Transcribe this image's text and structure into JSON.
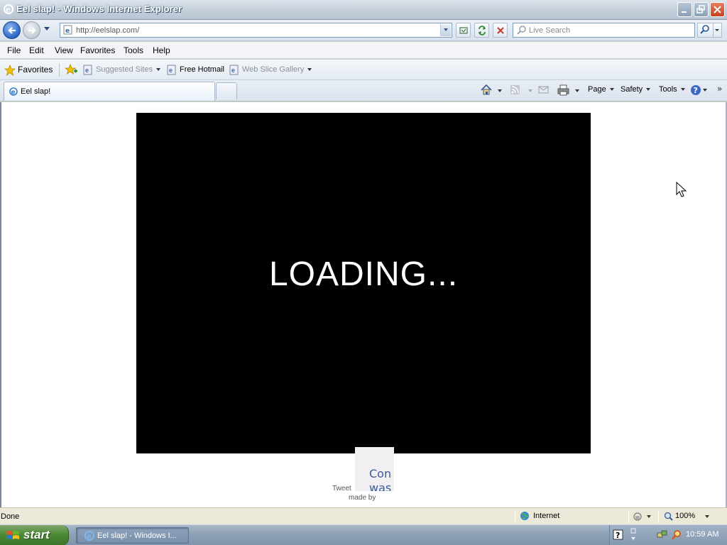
{
  "window": {
    "title": "Eel slap! - Windows Internet Explorer"
  },
  "address_bar": {
    "url": "http://eelslap.com/",
    "search_placeholder": "Live Search"
  },
  "menu": {
    "items": [
      "File",
      "Edit",
      "View",
      "Favorites",
      "Tools",
      "Help"
    ]
  },
  "favorites_bar": {
    "favorites_label": "Favorites",
    "links": [
      {
        "label": "Suggested Sites",
        "dimmed": true,
        "dropdown": true
      },
      {
        "label": "Free Hotmail",
        "dimmed": false,
        "dropdown": false
      },
      {
        "label": "Web Slice Gallery",
        "dimmed": true,
        "dropdown": true
      }
    ]
  },
  "tabs": {
    "active_label": "Eel slap!"
  },
  "command_bar": {
    "page_label": "Page",
    "safety_label": "Safety",
    "tools_label": "Tools"
  },
  "page": {
    "loading_text": "LOADING...",
    "promo_line1": "Con",
    "promo_line2": "was",
    "tweet_label": "Tweet",
    "made_by_label": "made by"
  },
  "status_bar": {
    "status": "Done",
    "zone": "Internet",
    "zoom": "100%"
  },
  "taskbar": {
    "start_label": "start",
    "task_label": "Eel slap! - Windows I...",
    "clock": "10:59 AM"
  },
  "colors": {
    "game_background": "#000000",
    "loading_text": "#ffffff",
    "start_button": "#3f7a2e"
  }
}
